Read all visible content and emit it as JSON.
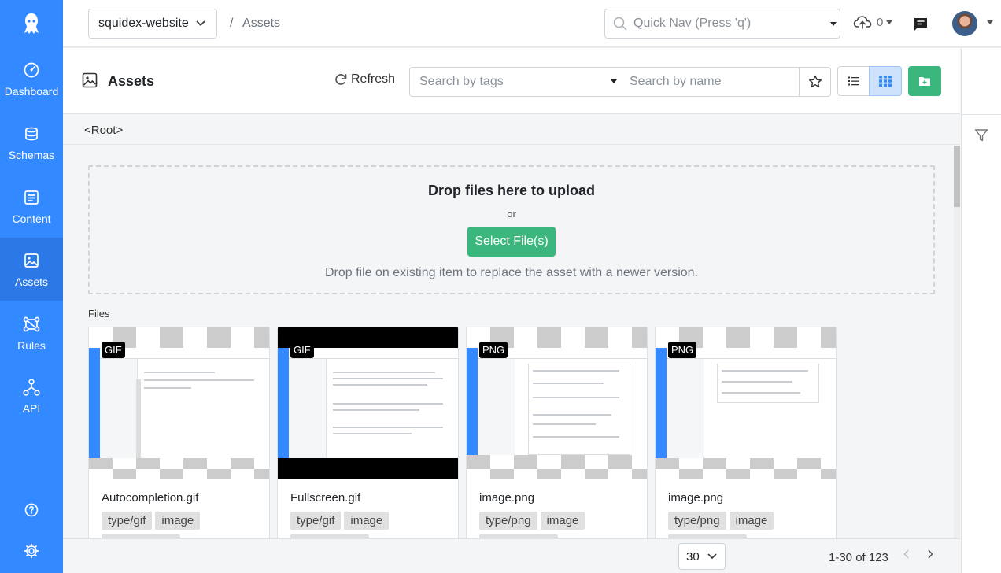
{
  "sidebar": {
    "logo_icon": "squidex-logo-icon",
    "items": [
      {
        "label": "Dashboard",
        "icon": "dashboard-icon"
      },
      {
        "label": "Schemas",
        "icon": "schemas-icon"
      },
      {
        "label": "Content",
        "icon": "content-icon"
      },
      {
        "label": "Assets",
        "icon": "assets-icon",
        "active": true
      },
      {
        "label": "Rules",
        "icon": "rules-icon"
      },
      {
        "label": "API",
        "icon": "api-icon"
      }
    ],
    "bottom": [
      "help-icon",
      "settings-icon"
    ]
  },
  "header": {
    "app_name": "squidex-website",
    "breadcrumb_sep": "/",
    "breadcrumb": "Assets",
    "quicknav_placeholder": "Quick Nav (Press 'q')",
    "upload_count": "0"
  },
  "panel": {
    "title": "Assets",
    "refresh_label": "Refresh",
    "tag_search_placeholder": "Search by tags",
    "name_search_placeholder": "Search by name",
    "path_root": "<Root>"
  },
  "dropzone": {
    "title": "Drop files here to upload",
    "or": "or",
    "button": "Select File(s)",
    "hint": "Drop file on existing item to replace the asset with a newer version."
  },
  "files_label": "Files",
  "assets": [
    {
      "name": "Autocompletion.gif",
      "badge": "GIF",
      "tags": [
        "type/gif",
        "image"
      ]
    },
    {
      "name": "Fullscreen.gif",
      "badge": "GIF",
      "tags": [
        "type/gif",
        "image"
      ]
    },
    {
      "name": "image.png",
      "badge": "PNG",
      "tags": [
        "type/png",
        "image"
      ]
    },
    {
      "name": "image.png",
      "badge": "PNG",
      "tags": [
        "type/png",
        "image"
      ]
    }
  ],
  "pager": {
    "page_size": "30",
    "info": "1-30 of 123"
  },
  "colors": {
    "sidebar": "#3389ff",
    "sidebar_active": "#2b78e6",
    "success": "#3bb77e"
  }
}
